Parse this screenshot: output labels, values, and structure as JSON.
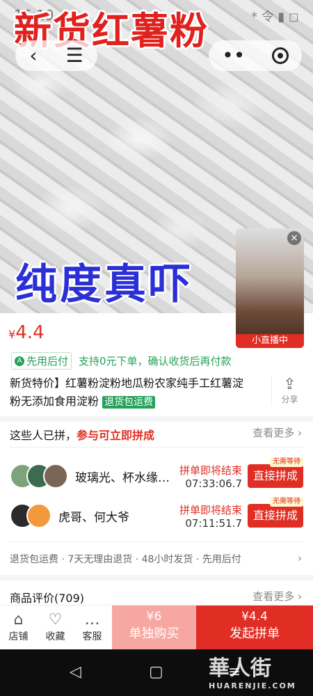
{
  "status": {
    "time": "16:19",
    "right": "* 令 ▮ ◻"
  },
  "hero": {
    "title": "新货红薯粉",
    "subtitle": "纯度真吓"
  },
  "nav": {
    "back_icon": "back-icon",
    "menu_icon": "menu-icon",
    "more_icon": "more-icon",
    "target_icon": "target-icon"
  },
  "live": {
    "close": "×",
    "badge": "小直播中"
  },
  "price": {
    "symbol": "¥",
    "value": "4.4"
  },
  "pay": {
    "tag": "先用后付",
    "text": "支持0元下单，确认收货后再付款"
  },
  "product": {
    "title": "新货特价】红薯粉淀粉地瓜粉农家纯手工红薯淀粉无添加食用淀粉",
    "badge": "退货包运费"
  },
  "share": {
    "label": "分享"
  },
  "joined": {
    "prefix": "这些人已拼，",
    "emph": "参与可立即拼成",
    "more": "查看更多"
  },
  "groups": [
    {
      "names": "玻璃光、杯水缘…",
      "end_label": "拼单即将结束",
      "time": "07:33:06.7",
      "no_wait": "无需等待",
      "button": "直接拼成"
    },
    {
      "names": "虎哥、何大爷",
      "end_label": "拼单即将结束",
      "time": "07:11:51.7",
      "no_wait": "无需等待",
      "button": "直接拼成"
    }
  ],
  "service": "退货包运费 · 7天无理由退货 · 48小时发货 · 先用后付",
  "reviews": {
    "label": "商品评价(709)",
    "more": "查看更多"
  },
  "bottom": {
    "shop": "店铺",
    "fav": "收藏",
    "cs": "客服",
    "solo_price": "¥6",
    "solo_label": "单独购买",
    "group_price": "¥4.4",
    "group_label": "发起拼单"
  },
  "watermark": {
    "main": "華人街",
    "sub": "HUARENJIE.COM"
  }
}
